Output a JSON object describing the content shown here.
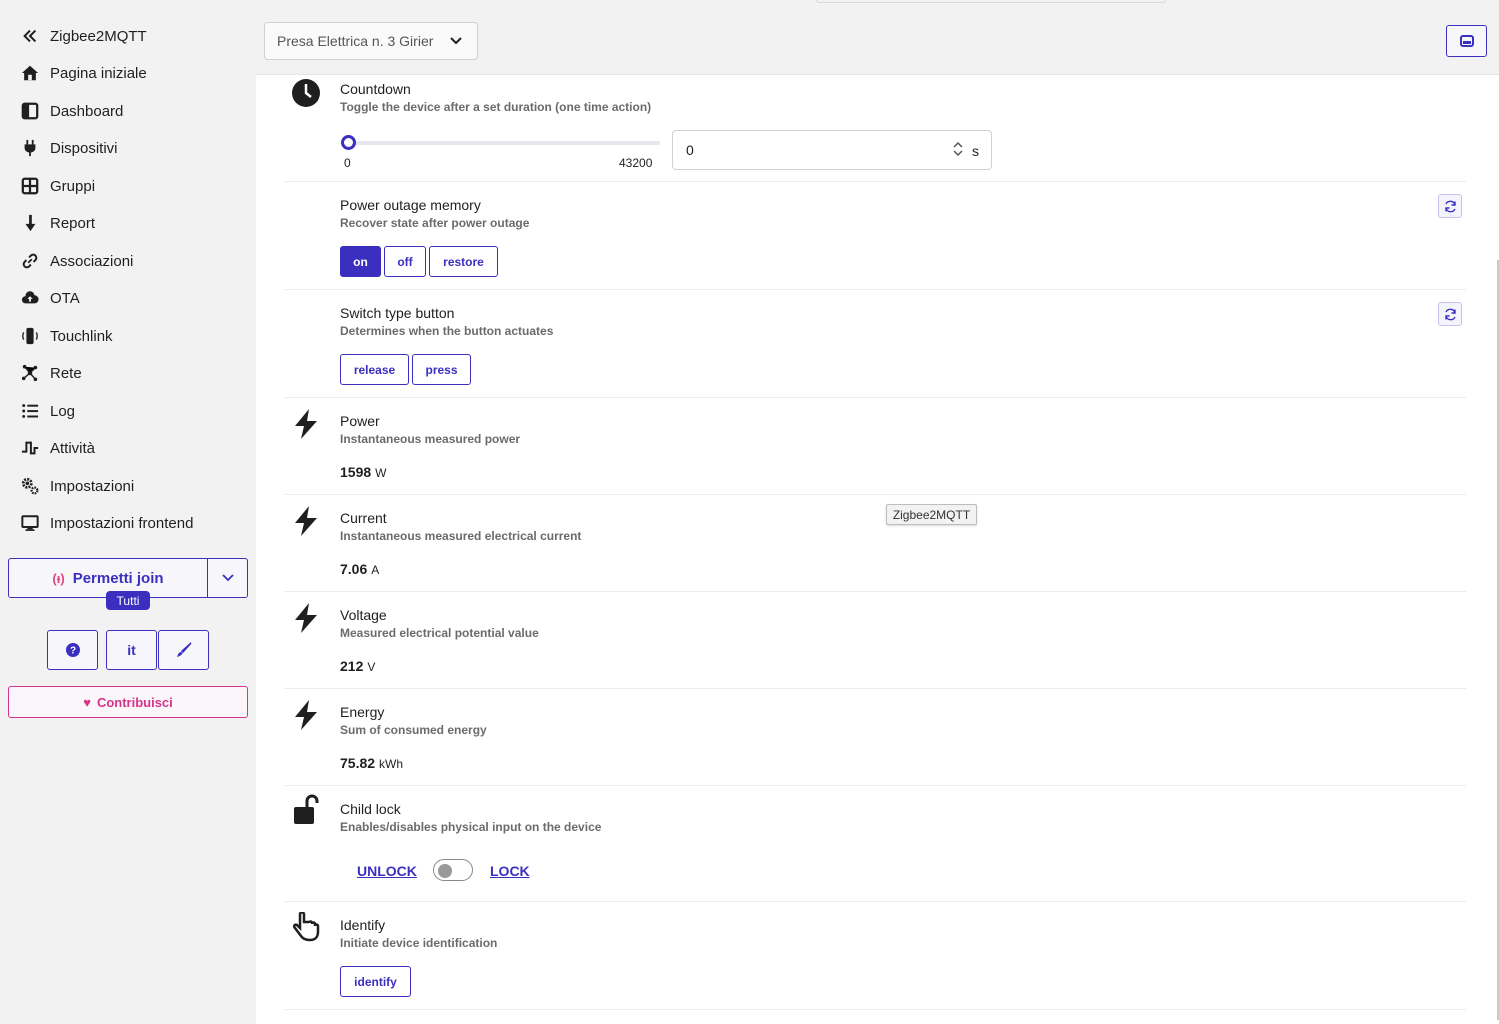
{
  "sidebar": {
    "brand": "Zigbee2MQTT",
    "items": [
      {
        "label": "Pagina iniziale",
        "icon": "home-icon"
      },
      {
        "label": "Dashboard",
        "icon": "dashboard-icon"
      },
      {
        "label": "Dispositivi",
        "icon": "plug-icon"
      },
      {
        "label": "Gruppi",
        "icon": "groups-icon"
      },
      {
        "label": "Report",
        "icon": "report-icon"
      },
      {
        "label": "Associazioni",
        "icon": "link-icon"
      },
      {
        "label": "OTA",
        "icon": "cloud-upload-icon"
      },
      {
        "label": "Touchlink",
        "icon": "touchlink-icon"
      },
      {
        "label": "Rete",
        "icon": "network-icon"
      },
      {
        "label": "Log",
        "icon": "list-icon"
      },
      {
        "label": "Attività",
        "icon": "activity-icon"
      },
      {
        "label": "Impostazioni",
        "icon": "gears-icon"
      },
      {
        "label": "Impostazioni frontend",
        "icon": "monitor-icon"
      }
    ],
    "permit_join": "Permetti join",
    "permit_target": "Tutti",
    "help_label": "?",
    "lang_label": "it",
    "contribute": "Contribuisci"
  },
  "topbar": {
    "device": "Presa Elettrica n. 3 Girier"
  },
  "features": {
    "countdown": {
      "title": "Countdown",
      "desc": "Toggle the device after a set duration (one time action)",
      "min": "0",
      "max": "43200",
      "value": "0",
      "unit": "s"
    },
    "power_outage": {
      "title": "Power outage memory",
      "desc": "Recover state after power outage",
      "options": [
        "on",
        "off",
        "restore"
      ],
      "selected": "on"
    },
    "switch_type": {
      "title": "Switch type button",
      "desc": "Determines when the button actuates",
      "options": [
        "release",
        "press"
      ]
    },
    "power": {
      "title": "Power",
      "desc": "Instantaneous measured power",
      "value": "1598",
      "unit": "W"
    },
    "current": {
      "title": "Current",
      "desc": "Instantaneous measured electrical current",
      "value": "7.06",
      "unit": "A"
    },
    "voltage": {
      "title": "Voltage",
      "desc": "Measured electrical potential value",
      "value": "212",
      "unit": "V"
    },
    "energy": {
      "title": "Energy",
      "desc": "Sum of consumed energy",
      "value": "75.82",
      "unit": "kWh"
    },
    "child_lock": {
      "title": "Child lock",
      "desc": "Enables/disables physical input on the device",
      "off_label": "UNLOCK",
      "on_label": "LOCK"
    },
    "identify": {
      "title": "Identify",
      "desc": "Initiate device identification",
      "button": "identify"
    }
  },
  "tooltip": "Zigbee2MQTT",
  "colors": {
    "accent": "#3b2fbf",
    "pink": "#d6338c",
    "sidebar_bg": "#f2f2f2"
  }
}
